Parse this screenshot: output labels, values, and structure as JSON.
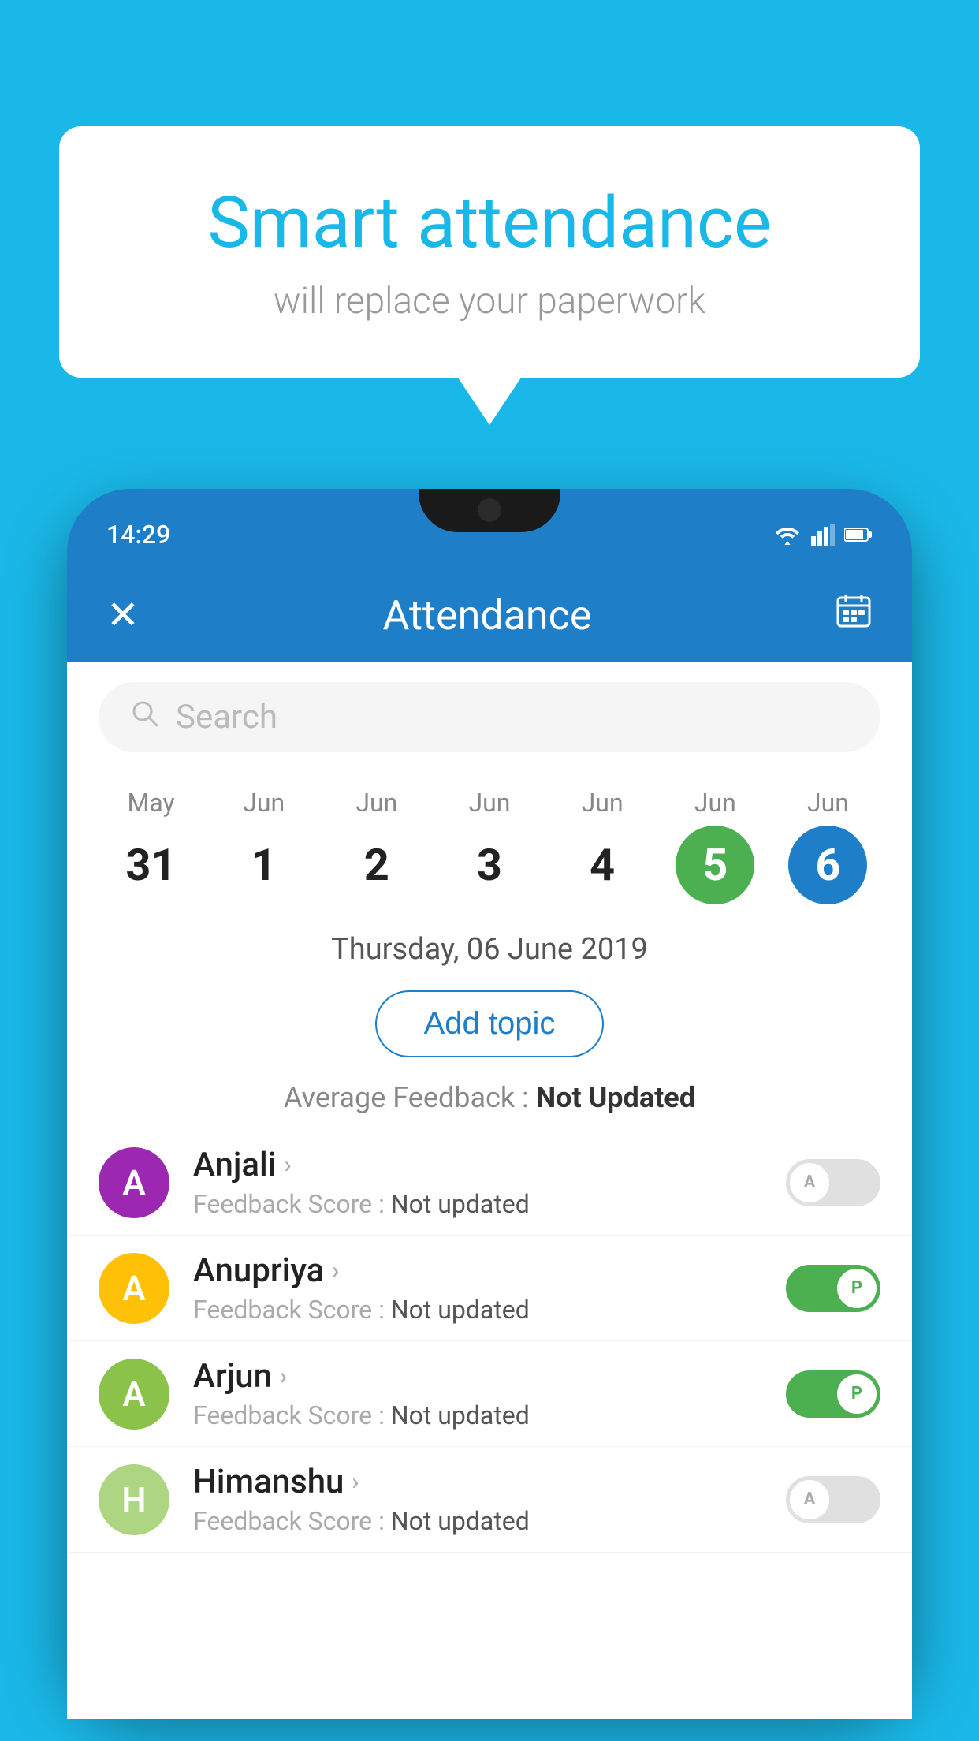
{
  "background_color": "#1ab8e8",
  "speech_bubble": {
    "title": "Smart attendance",
    "subtitle": "will replace your paperwork"
  },
  "status_bar": {
    "time": "14:29",
    "wifi_icon": "wifi",
    "signal_icon": "signal",
    "battery_icon": "battery"
  },
  "app_header": {
    "close_label": "✕",
    "title": "Attendance",
    "calendar_icon": "calendar"
  },
  "search": {
    "placeholder": "Search"
  },
  "calendar": {
    "days": [
      {
        "month": "May",
        "date": "31",
        "style": "normal"
      },
      {
        "month": "Jun",
        "date": "1",
        "style": "normal"
      },
      {
        "month": "Jun",
        "date": "2",
        "style": "normal"
      },
      {
        "month": "Jun",
        "date": "3",
        "style": "normal"
      },
      {
        "month": "Jun",
        "date": "4",
        "style": "normal"
      },
      {
        "month": "Jun",
        "date": "5",
        "style": "green"
      },
      {
        "month": "Jun",
        "date": "6",
        "style": "blue"
      }
    ]
  },
  "selected_date": "Thursday, 06 June 2019",
  "add_topic_label": "Add topic",
  "average_feedback": {
    "label": "Average Feedback : ",
    "value": "Not Updated"
  },
  "students": [
    {
      "name": "Anjali",
      "avatar_letter": "A",
      "avatar_color": "#9c27b0",
      "feedback_label": "Feedback Score : ",
      "feedback_value": "Not updated",
      "attendance": "absent",
      "toggle_letter": "A"
    },
    {
      "name": "Anupriya",
      "avatar_letter": "A",
      "avatar_color": "#ffc107",
      "feedback_label": "Feedback Score : ",
      "feedback_value": "Not updated",
      "attendance": "present",
      "toggle_letter": "P"
    },
    {
      "name": "Arjun",
      "avatar_letter": "A",
      "avatar_color": "#8bc34a",
      "feedback_label": "Feedback Score : ",
      "feedback_value": "Not updated",
      "attendance": "present",
      "toggle_letter": "P"
    },
    {
      "name": "Himanshu",
      "avatar_letter": "H",
      "avatar_color": "#aed581",
      "feedback_label": "Feedback Score : ",
      "feedback_value": "Not updated",
      "attendance": "absent",
      "toggle_letter": "A"
    }
  ]
}
